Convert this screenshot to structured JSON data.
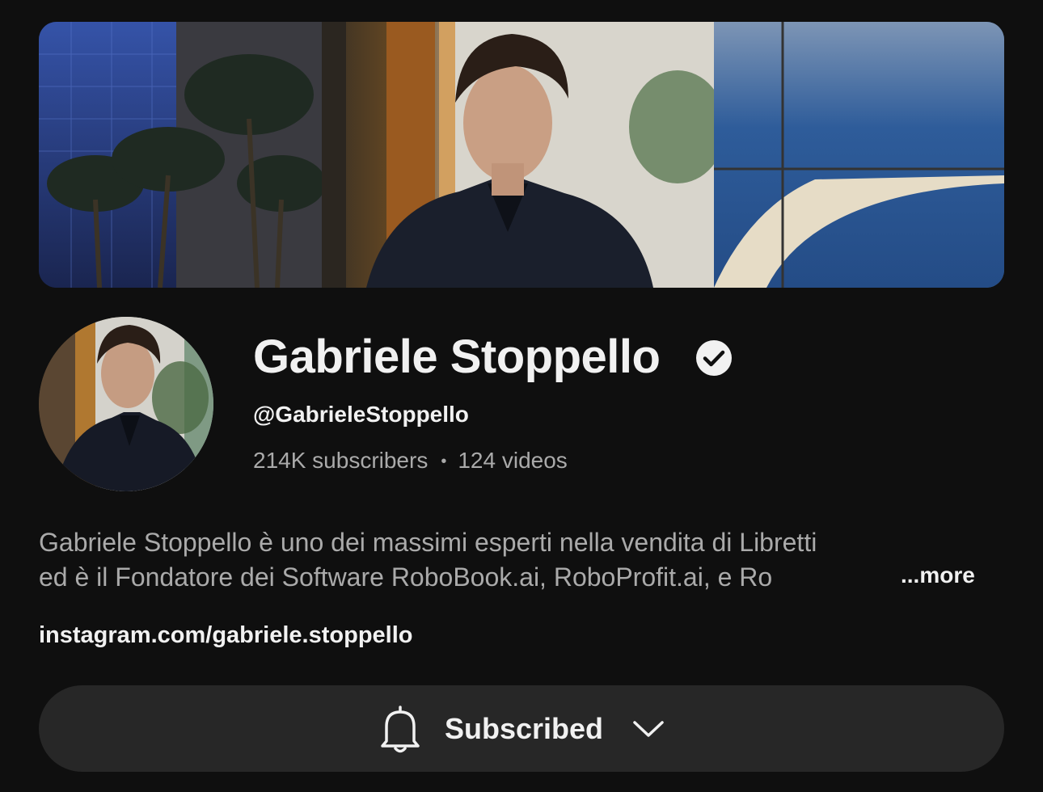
{
  "banner": {
    "image": "channel-banner-photo"
  },
  "channel": {
    "avatar": "channel-avatar-photo",
    "name": "Gabriele Stoppello",
    "verified_icon": "verified-check-icon",
    "handle": "@GabrieleStoppello",
    "subscribers": "214K subscribers",
    "separator": "•",
    "videos": "124 videos"
  },
  "description": {
    "line1": "Gabriele Stoppello è uno dei massimi esperti nella vendita di Libretti",
    "line2": "ed è il Fondatore dei Software RoboBook.ai, RoboProfit.ai, e Ro",
    "more_label": "...more"
  },
  "link": {
    "text": "instagram.com/gabriele.stoppello"
  },
  "subscribe_button": {
    "icon": "bell-icon",
    "label": "Subscribed",
    "dropdown_icon": "chevron-down-icon"
  },
  "colors": {
    "background": "#0f0f0f",
    "primary_text": "#f1f1f1",
    "secondary_text": "#aaaaaa",
    "button_bg": "#272727"
  }
}
